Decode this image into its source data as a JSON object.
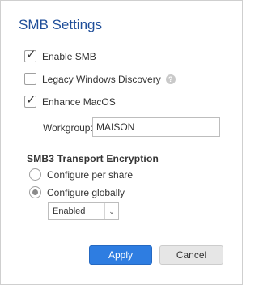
{
  "dialog": {
    "title": "SMB Settings"
  },
  "options": {
    "enable_smb": {
      "label": "Enable SMB",
      "checked": true
    },
    "legacy_discovery": {
      "label": "Legacy Windows Discovery",
      "checked": false,
      "help_icon": "?"
    },
    "enhance_macos": {
      "label": "Enhance MacOS",
      "checked": true
    }
  },
  "workgroup": {
    "label": "Workgroup:",
    "value": "MAISON"
  },
  "encryption": {
    "heading": "SMB3 Transport Encryption",
    "per_share": {
      "label": "Configure per share",
      "selected": false
    },
    "globally": {
      "label": "Configure globally",
      "selected": true
    },
    "global_mode": {
      "value": "Enabled",
      "arrow": "⌄"
    }
  },
  "buttons": {
    "apply": "Apply",
    "cancel": "Cancel"
  },
  "colors": {
    "title": "#1f4e99",
    "apply_bg": "#2e7de1",
    "cancel_bg": "#e6e6e6"
  },
  "icons": {
    "check": "✓"
  }
}
